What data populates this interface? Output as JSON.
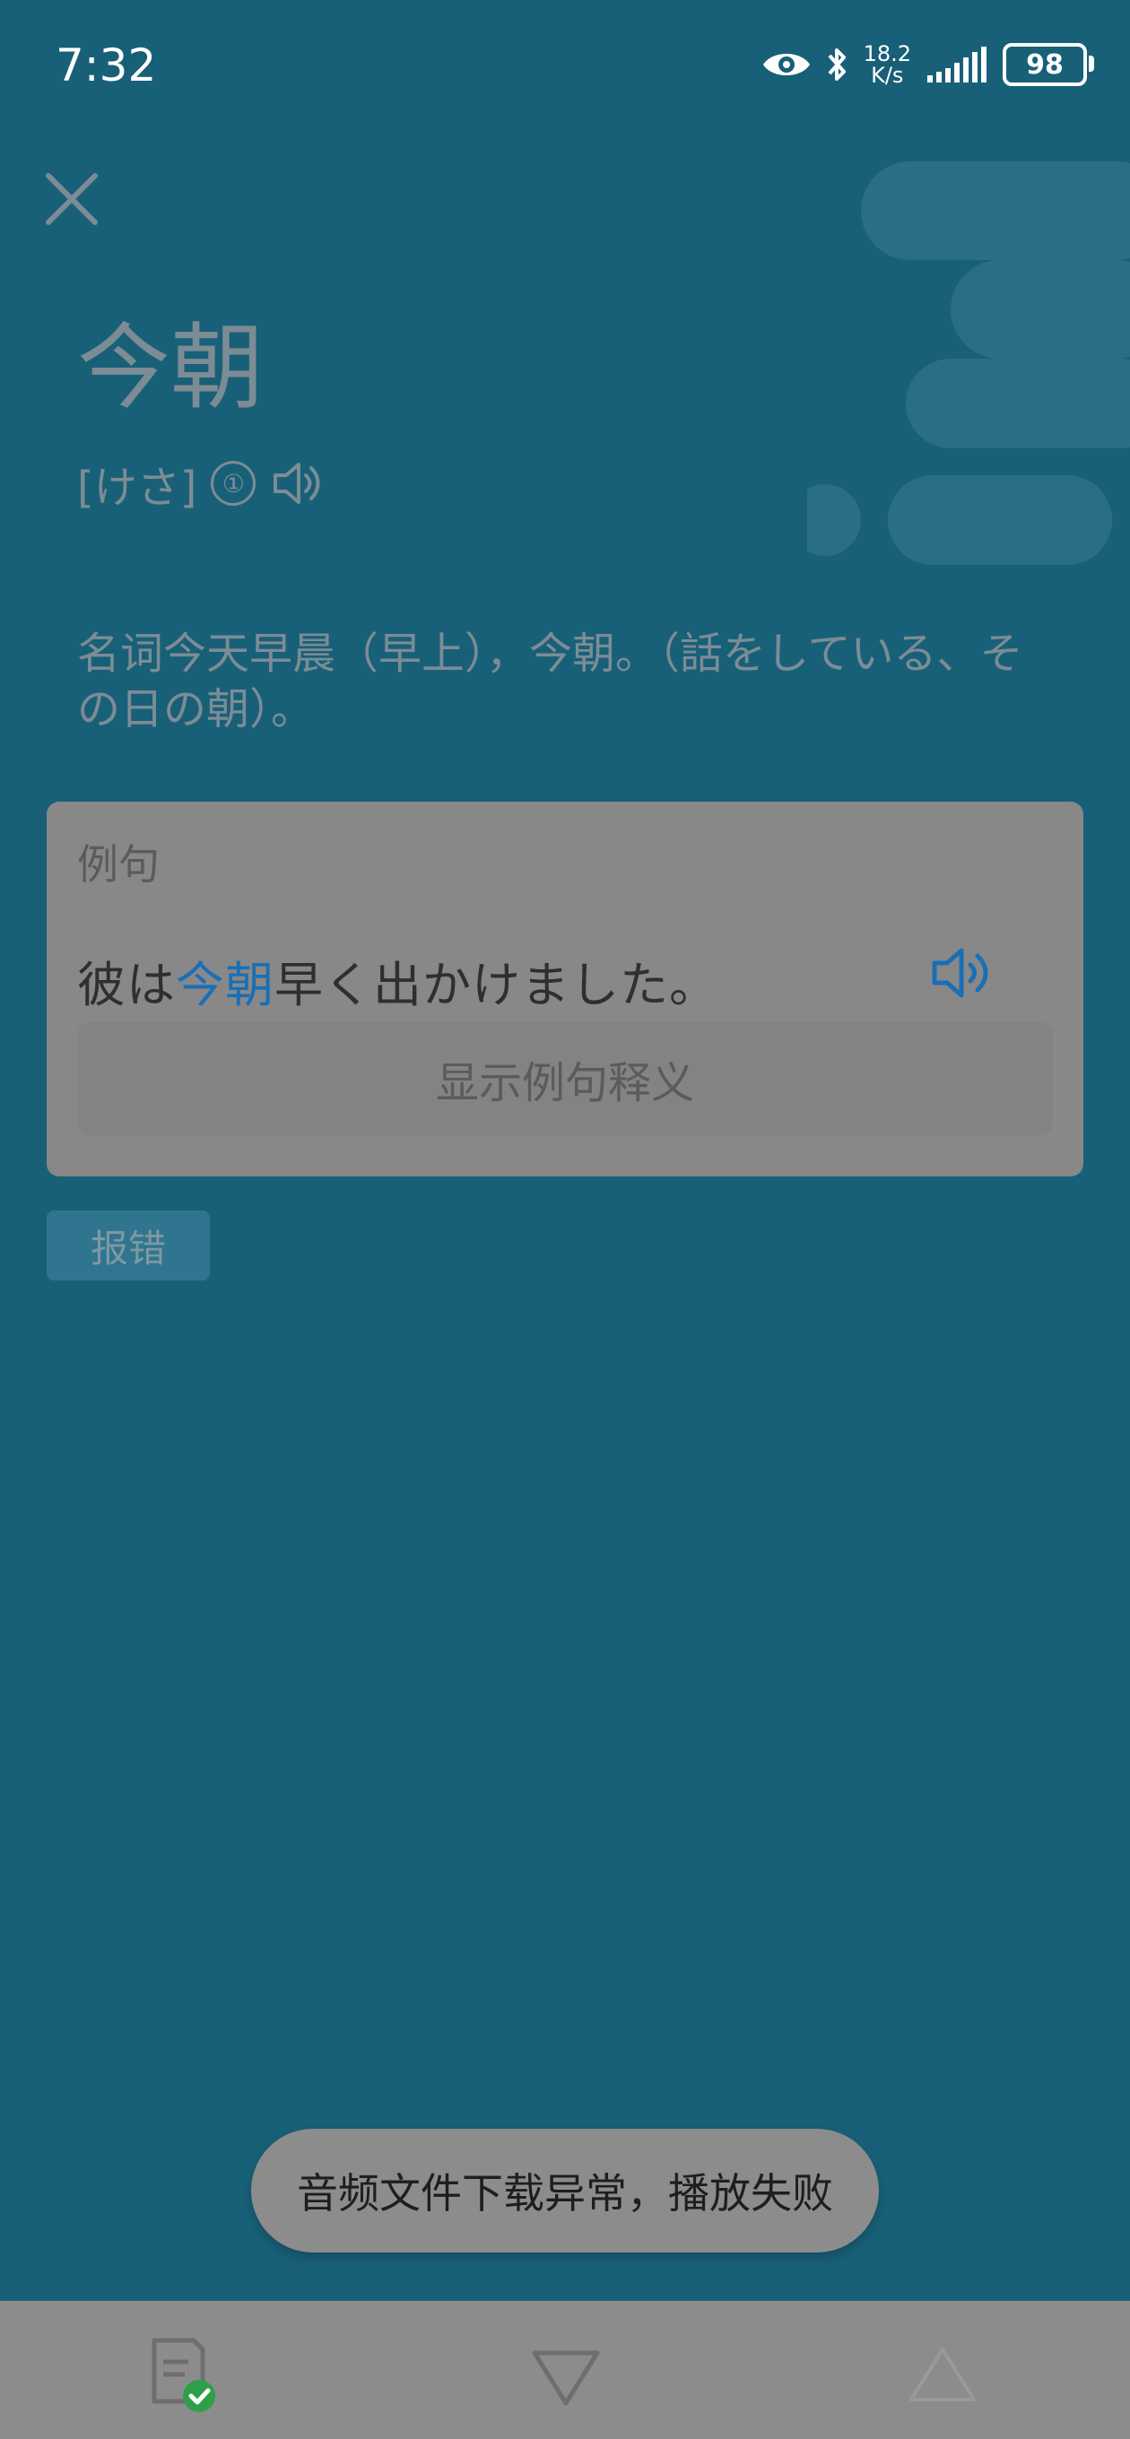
{
  "status_bar": {
    "time": "7:32",
    "net_speed_value": "18.2",
    "net_speed_unit": "K/s",
    "battery": "98"
  },
  "word": {
    "title": "今朝",
    "reading": "[けさ]",
    "pitch": "①"
  },
  "definition": "名词今天早晨（早上），今朝。（話をしている、その日の朝）。",
  "example_card": {
    "title": "例句",
    "sentence_before": "彼は",
    "sentence_highlight": "今朝",
    "sentence_after": "早く出かけました。",
    "show_meaning": "显示例句释义"
  },
  "report_button": "报错",
  "toast": "音频文件下载异常，播放失败",
  "colors": {
    "background": "#186078",
    "accent": "#1a6fb5",
    "overlay_gray": "#8c8c8c",
    "success_green": "#2e9f4a"
  },
  "icons": [
    "close-icon",
    "speaker-icon",
    "eye-icon",
    "bluetooth-icon",
    "signal-icon",
    "battery-icon",
    "note-check-icon",
    "triangle-down-icon",
    "triangle-up-icon"
  ]
}
